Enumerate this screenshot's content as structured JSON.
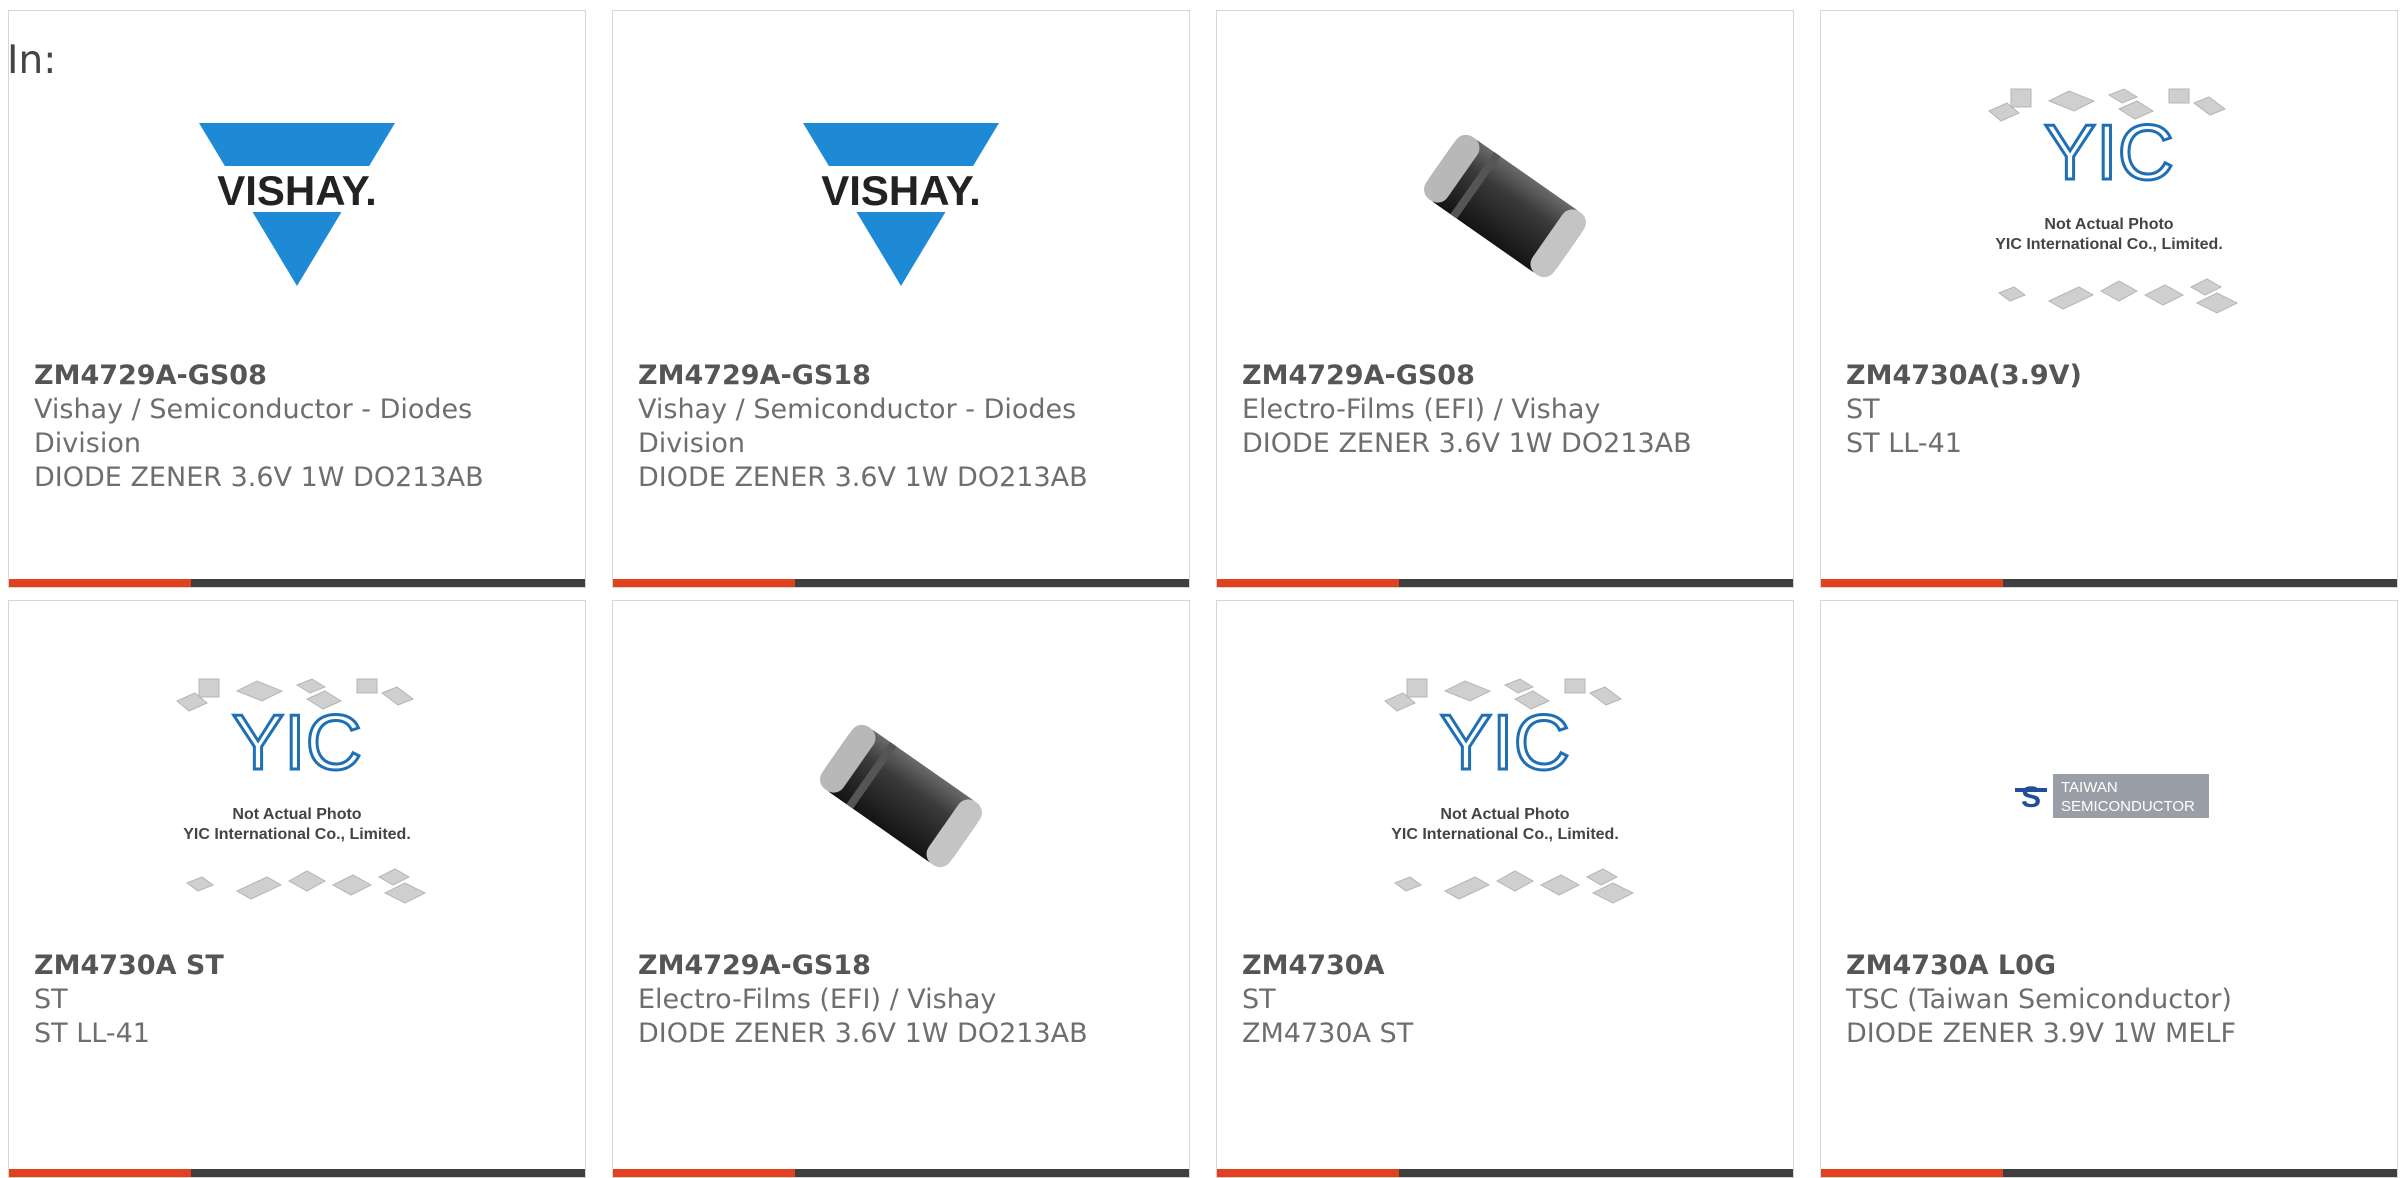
{
  "header": {
    "in_label": "In:"
  },
  "products": [
    {
      "part_number": "ZM4729A-GS08",
      "manufacturer": "Vishay / Semiconductor - Diodes Division",
      "description": "DIODE ZENER 3.6V 1W DO213AB",
      "image": "vishay-logo",
      "brand_text": "VISHAY."
    },
    {
      "part_number": "ZM4729A-GS18",
      "manufacturer": "Vishay / Semiconductor - Diodes Division",
      "description": "DIODE ZENER 3.6V 1W DO213AB",
      "image": "vishay-logo",
      "brand_text": "VISHAY."
    },
    {
      "part_number": "ZM4729A-GS08",
      "manufacturer": "Electro-Films (EFI) / Vishay",
      "description": "DIODE ZENER 3.6V 1W DO213AB",
      "image": "melf-diode-photo"
    },
    {
      "part_number": "ZM4730A(3.9V)",
      "manufacturer": "ST",
      "description": "ST LL-41",
      "image": "yic-placeholder",
      "placeholder_line1": "Not Actual Photo",
      "placeholder_line2": "YIC International Co., Limited."
    },
    {
      "part_number": "ZM4730A ST",
      "manufacturer": "ST",
      "description": "ST LL-41",
      "image": "yic-placeholder",
      "placeholder_line1": "Not Actual Photo",
      "placeholder_line2": "YIC International Co., Limited."
    },
    {
      "part_number": "ZM4729A-GS18",
      "manufacturer": "Electro-Films (EFI) / Vishay",
      "description": "DIODE ZENER 3.6V 1W DO213AB",
      "image": "melf-diode-photo"
    },
    {
      "part_number": "ZM4730A",
      "manufacturer": "ST",
      "description": "ZM4730A ST",
      "image": "yic-placeholder",
      "placeholder_line1": "Not Actual Photo",
      "placeholder_line2": "YIC International Co., Limited."
    },
    {
      "part_number": "ZM4730A L0G",
      "manufacturer": "TSC (Taiwan Semiconductor)",
      "description": "DIODE ZENER 3.9V 1W MELF",
      "image": "taiwan-semiconductor-logo",
      "brand_line1": "TAIWAN",
      "brand_line2": "SEMICONDUCTOR"
    }
  ],
  "colors": {
    "accent": "#e1411f",
    "bar": "#3f3f3f",
    "vishay_blue": "#1e8ad6",
    "yic_blue": "#1f6fb5"
  }
}
